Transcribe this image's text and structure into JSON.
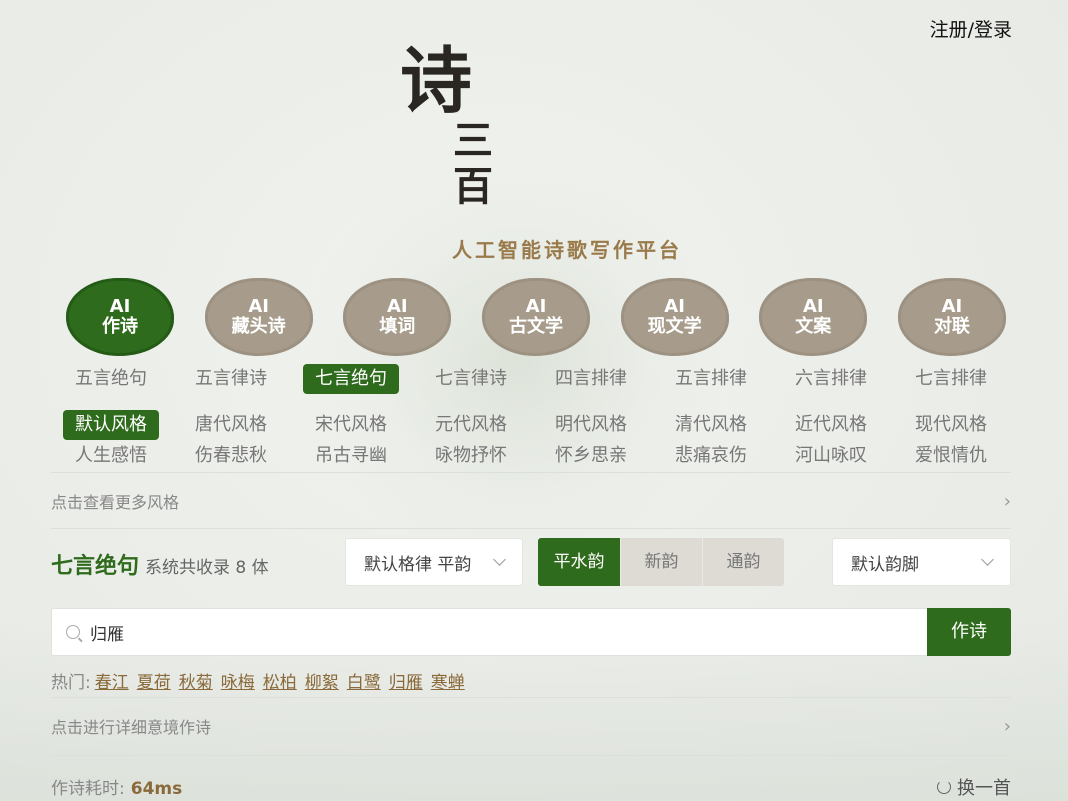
{
  "header": {
    "login_label": "注册/登录"
  },
  "logo": {
    "big": "诗",
    "small": "三百",
    "tagline": "人工智能诗歌写作平台"
  },
  "modes": [
    {
      "line1": "AI",
      "line2": "作诗",
      "active": true
    },
    {
      "line1": "AI",
      "line2": "藏头诗",
      "active": false
    },
    {
      "line1": "AI",
      "line2": "填词",
      "active": false
    },
    {
      "line1": "AI",
      "line2": "古文学",
      "active": false
    },
    {
      "line1": "AI",
      "line2": "现文学",
      "active": false
    },
    {
      "line1": "AI",
      "line2": "文案",
      "active": false
    },
    {
      "line1": "AI",
      "line2": "对联",
      "active": false
    }
  ],
  "forms": [
    "五言绝句",
    "五言律诗",
    "七言绝句",
    "七言律诗",
    "四言排律",
    "五言排律",
    "六言排律",
    "七言排律"
  ],
  "styles_row1": [
    "默认风格",
    "唐代风格",
    "宋代风格",
    "元代风格",
    "明代风格",
    "清代风格",
    "近代风格",
    "现代风格"
  ],
  "styles_row2": [
    "人生感悟",
    "伤春悲秋",
    "吊古寻幽",
    "咏物抒怀",
    "怀乡思亲",
    "悲痛哀伤",
    "河山咏叹",
    "爱恨情仇"
  ],
  "more_styles": "点击查看更多风格",
  "form": {
    "name": "七言绝句",
    "count_text": "系统共收录 8 体",
    "meter_select": "默认格律 平韵",
    "rhyme_tabs": [
      "平水韵",
      "新韵",
      "通韵"
    ],
    "rhyme_select": "默认韵脚"
  },
  "search": {
    "value": "归雁",
    "button": "作诗"
  },
  "hot": {
    "label": "热门:",
    "topics": [
      "春江",
      "夏荷",
      "秋菊",
      "咏梅",
      "松柏",
      "柳絮",
      "白鹭",
      "归雁",
      "寒蝉"
    ]
  },
  "detail_link": "点击进行详细意境作诗",
  "timing": {
    "label": "作诗耗时:",
    "value": "64ms"
  },
  "refresh_label": "换一首",
  "colors": {
    "accent": "#2f6b1c",
    "mode_inactive": "#a79c8b",
    "hot_link": "#8a6a3a"
  }
}
